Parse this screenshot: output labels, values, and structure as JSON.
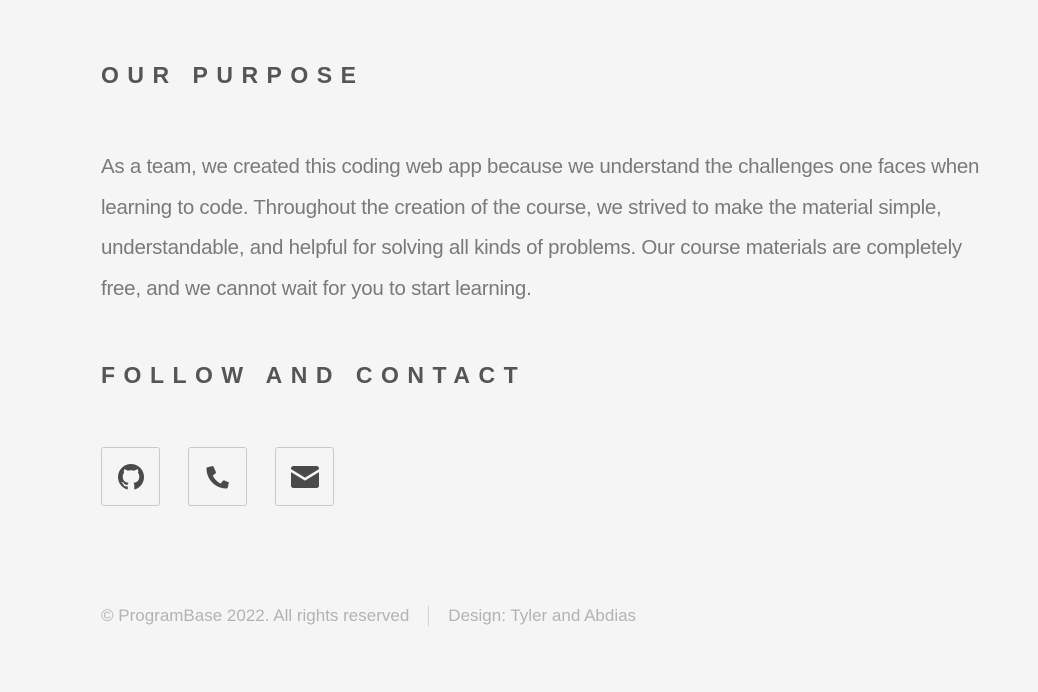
{
  "purpose": {
    "title": "OUR PURPOSE",
    "text": "As a team, we created this coding web app because we understand the challenges one faces when learning to code. Throughout the creation of the course, we strived to make the material simple, understandable, and helpful for solving all kinds of problems. Our course materials are completely free, and we cannot wait for you to start learning."
  },
  "follow": {
    "title": "FOLLOW AND CONTACT",
    "icons": [
      "github-icon",
      "phone-icon",
      "envelope-icon"
    ]
  },
  "footer": {
    "copyright": "© ProgramBase 2022. All rights reserved",
    "design": "Design: Tyler and Abdias"
  }
}
